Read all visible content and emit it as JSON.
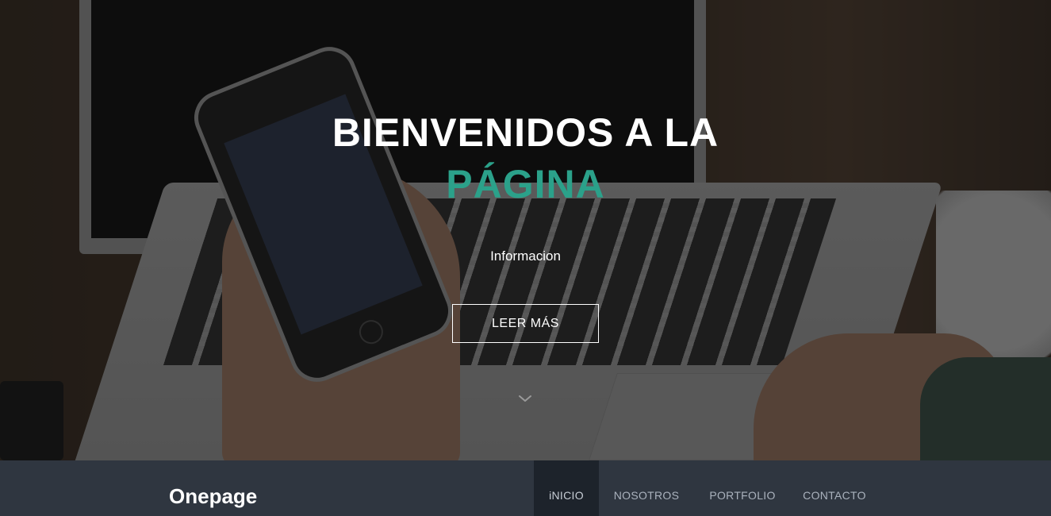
{
  "hero": {
    "title_line1": "BIENVENIDOS A LA",
    "title_line2": "PÁGINA",
    "subtitle": "Informacion",
    "button_label": "LEER MÁS",
    "scroll_icon": "chevron-down-icon",
    "accent_color": "#2ba18a"
  },
  "navbar": {
    "brand": "Onepage",
    "items": [
      {
        "label": "iNICIO",
        "active": true
      },
      {
        "label": "NOSOTROS",
        "active": false
      },
      {
        "label": "PORTFOLIO",
        "active": false
      },
      {
        "label": "CONTACTO",
        "active": false
      }
    ],
    "background_color": "#2f3640",
    "active_color": "#1d232b"
  }
}
